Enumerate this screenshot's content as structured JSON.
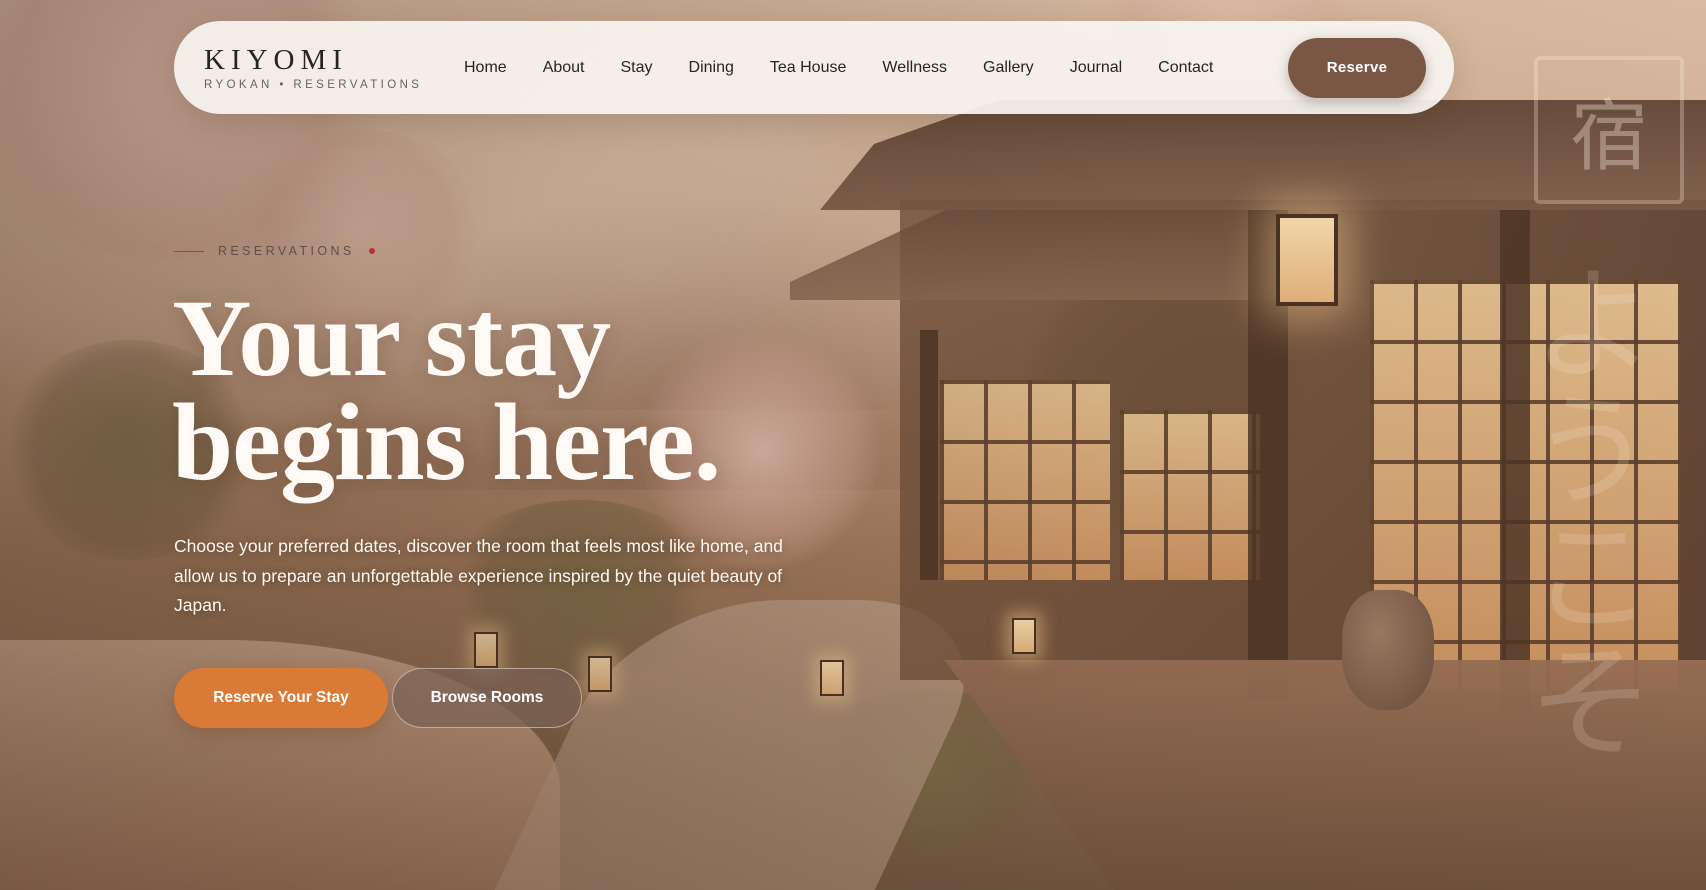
{
  "brand": {
    "name": "KIYOMI",
    "tagline": "RYOKAN • RESERVATIONS"
  },
  "nav": {
    "links": [
      "Home",
      "About",
      "Stay",
      "Dining",
      "Tea House",
      "Wellness",
      "Gallery",
      "Journal",
      "Contact"
    ],
    "reserve_label": "Reserve"
  },
  "hero": {
    "eyebrow": "RESERVATIONS",
    "headline_line1": "Your stay",
    "headline_line2": "begins here.",
    "lede": "Choose your preferred dates, discover the room that feels most like home, and allow us to prepare an unforgettable experience inspired by the quiet beauty of Japan.",
    "primary_cta": "Reserve Your Stay",
    "secondary_cta": "Browse Rooms"
  },
  "decoration": {
    "kanji_box": "宿",
    "kanji_vertical": "ようこそ"
  },
  "colors": {
    "accent_orange": "#d97a36",
    "reserve_brown": "#7a5644",
    "eyebrow_dot_red": "#b8322c",
    "headline_white": "#fffaf5"
  }
}
